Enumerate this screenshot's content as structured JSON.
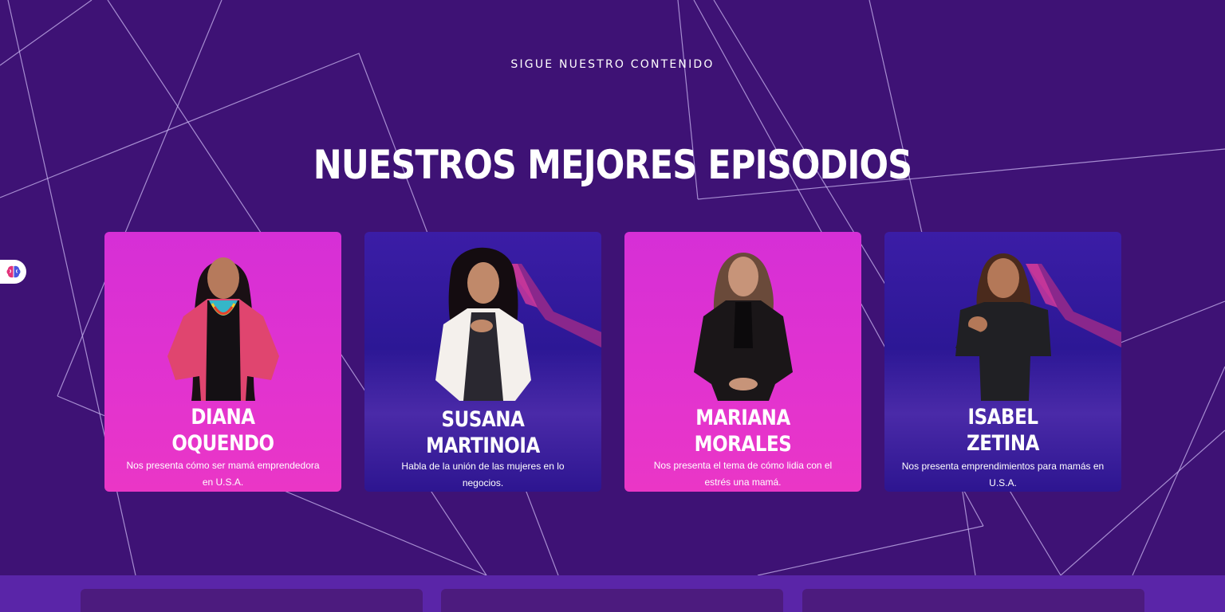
{
  "section": {
    "eyebrow": "SIGUE NUESTRO CONTENIDO",
    "headline": "NUESTROS MEJORES EPISODIOS"
  },
  "colors": {
    "background": "#3e1275",
    "card_pink": "#e233cf",
    "card_blue": "#2c1795",
    "bottom_band": "#5a25a8"
  },
  "episodes": [
    {
      "name_line1": "DIANA",
      "name_line2": "OQUENDO",
      "description": "Nos presenta cómo ser mamá emprendedora en U.S.A.",
      "style": "pink"
    },
    {
      "name_line1": "SUSANA",
      "name_line2": "MARTINOIA",
      "description": "Habla de la unión de las mujeres en lo negocios.",
      "style": "blue"
    },
    {
      "name_line1": "MARIANA",
      "name_line2": "MORALES",
      "description": "Nos presenta el tema de cómo lidia con el estrés una mamá.",
      "style": "pink"
    },
    {
      "name_line1": "ISABEL",
      "name_line2": "ZETINA",
      "description": "Nos presenta emprendimientos para mamás en U.S.A.",
      "style": "blue"
    }
  ],
  "side_widget": {
    "icon": "brain-icon"
  }
}
